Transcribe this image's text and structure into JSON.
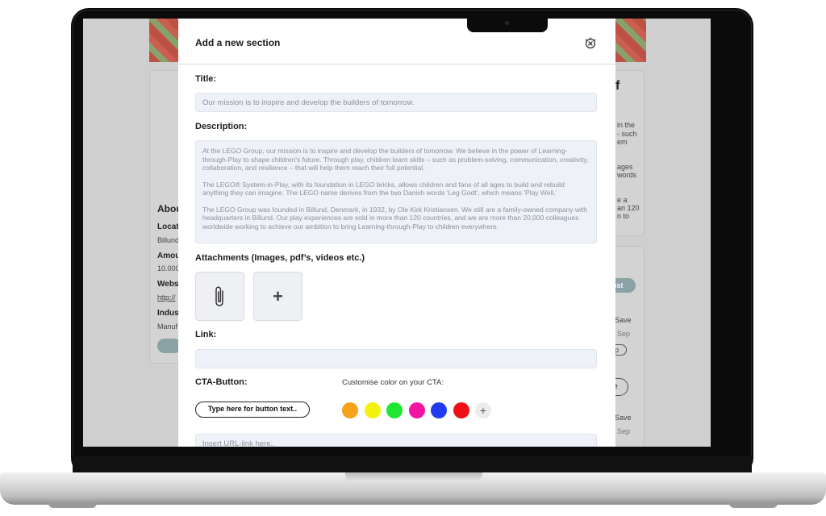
{
  "background": {
    "about_heading": "Abou",
    "rows": [
      {
        "label": "Locat",
        "value": "Billund"
      },
      {
        "label": "Amou",
        "value": "10.000"
      },
      {
        "label": "Webs",
        "value": "http://"
      },
      {
        "label": "Indus",
        "value": "Manuf"
      }
    ],
    "right_fragments": [
      "f",
      "in the",
      "- such",
      "em",
      "ages",
      "words",
      "e a",
      "an 120",
      "n to",
      "ost",
      "Save",
      "Sep",
      "p",
      "e",
      "Save",
      "Sep",
      "p"
    ]
  },
  "modal": {
    "title": "Add a new section",
    "close_icon": "close-circle-icon",
    "title_label": "Title:",
    "title_placeholder": "Our mission is to inspire and develop the builders of tomorrow.",
    "description_label": "Description:",
    "description_paragraphs": [
      "At the LEGO Group, our mission is to inspire and develop the builders of tomorrow. We believe in the power of Learning-through-Play to shape children's future. Through play, children learn skills – such as problem-solving, communication, creativity, collaboration, and resilience – that will help them reach their full potential.",
      "The LEGO® System-in-Play, with its foundation in LEGO bricks, allows children and fans of all ages to build and rebuild anything they can imagine. The LEGO name derives from the two Danish words ‘Leg Godt’, which means ‘Play Well.’",
      "The LEGO Group was founded in Billund, Denmark, in 1932, by Ole Kirk Kristiansen. We still are a family-owned company with headquarters in Billund. Our play experiences are sold in more than 120 countries, and we are more than 20,000 colleagues worldwide working to achieve our ambition to bring Learning-through-Play to children everywhere."
    ],
    "attachments_label": "Attachments (Images, pdf’s, videos etc.)",
    "attachment_icons": [
      "paperclip-icon",
      "plus-icon"
    ],
    "link_label": "Link:",
    "link_value": "",
    "cta_label": "CTA-Button:",
    "cta_button_text": "Type here for button text..",
    "color_label": "Customise color on your CTA:",
    "colors": [
      "#f7a21b",
      "#f2f20f",
      "#1ee632",
      "#f016a3",
      "#1f3cf2",
      "#ef0f16"
    ],
    "add_color": "+",
    "url_placeholder": "Insert URL-link here.."
  }
}
